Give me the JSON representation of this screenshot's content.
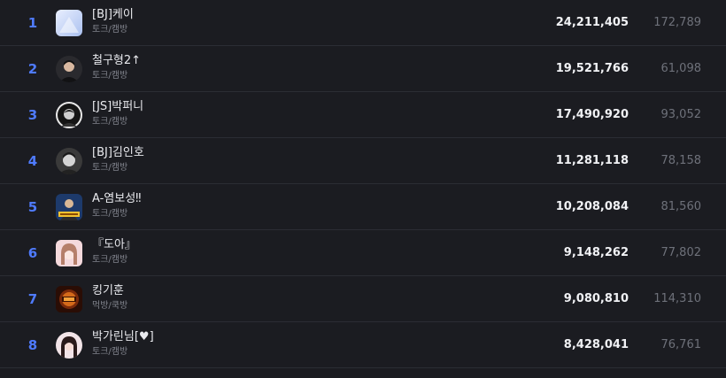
{
  "rows": [
    {
      "rank": "1",
      "name": "[BJ]케이",
      "category": "토크/캠방",
      "views": "24,211,405",
      "secondary": "172,789",
      "avatar": "avatar-light"
    },
    {
      "rank": "2",
      "name": "철구형2↑",
      "category": "토크/캠방",
      "views": "19,521,766",
      "secondary": "61,098",
      "avatar": "avatar-dark"
    },
    {
      "rank": "3",
      "name": "[JS]박퍼니",
      "category": "토크/캠방",
      "views": "17,490,920",
      "secondary": "93,052",
      "avatar": "avatar-mono"
    },
    {
      "rank": "4",
      "name": "[BJ]김인호",
      "category": "토크/캠방",
      "views": "11,281,118",
      "secondary": "78,158",
      "avatar": "avatar-gray"
    },
    {
      "rank": "5",
      "name": "A-염보성‼",
      "category": "토크/캠방",
      "views": "10,208,084",
      "secondary": "81,560",
      "avatar": "avatar-blue"
    },
    {
      "rank": "6",
      "name": "『도아』",
      "category": "토크/캠방",
      "views": "9,148,262",
      "secondary": "77,802",
      "avatar": "avatar-pink"
    },
    {
      "rank": "7",
      "name": "킹기훈",
      "category": "먹방/쿡방",
      "views": "9,080,810",
      "secondary": "114,310",
      "avatar": "avatar-gold"
    },
    {
      "rank": "8",
      "name": "박가린님[♥]",
      "category": "토크/캠방",
      "views": "8,428,041",
      "secondary": "76,761",
      "avatar": "avatar-rose"
    }
  ],
  "colors": {
    "rank": "#4f7bff",
    "background": "#1b1c21",
    "divider": "#2b2d34"
  }
}
